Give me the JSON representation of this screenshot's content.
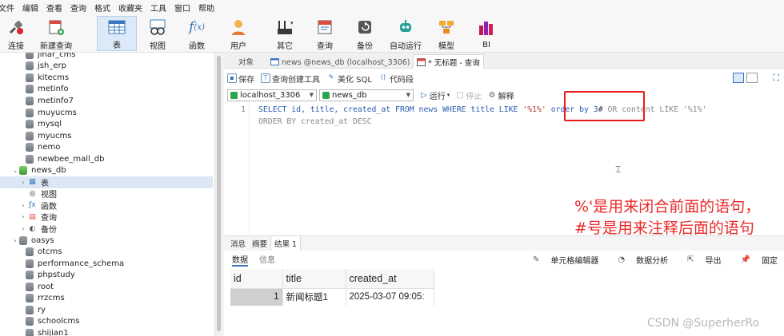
{
  "menu": [
    "文件",
    "编辑",
    "查看",
    "查询",
    "格式",
    "收藏夹",
    "工具",
    "窗口",
    "帮助"
  ],
  "toolbar": {
    "items": [
      {
        "label": "连接",
        "icon": "connect-icon"
      },
      {
        "label": "新建查询",
        "icon": "new-query-icon"
      },
      {
        "label": "表",
        "icon": "table-icon"
      },
      {
        "label": "视图",
        "icon": "view-icon"
      },
      {
        "label": "函数",
        "icon": "function-icon"
      },
      {
        "label": "用户",
        "icon": "user-icon"
      },
      {
        "label": "其它",
        "icon": "other-icon"
      },
      {
        "label": "查询",
        "icon": "query-icon"
      },
      {
        "label": "备份",
        "icon": "backup-icon"
      },
      {
        "label": "自动运行",
        "icon": "robot-icon"
      },
      {
        "label": "模型",
        "icon": "model-icon"
      },
      {
        "label": "BI",
        "icon": "bi-icon"
      }
    ]
  },
  "sidebar": {
    "databases_top": [
      "jinar_cms",
      "jsh_erp",
      "kitecms",
      "metinfo",
      "metinfo7",
      "muyucms",
      "mysql",
      "myucms",
      "nemo",
      "newbee_mall_db",
      "news_db"
    ],
    "news_db_children": [
      "表",
      "视图",
      "函数",
      "查询",
      "备份"
    ],
    "databases_bottom": [
      "oasys",
      "otcms",
      "performance_schema",
      "phpstudy",
      "root",
      "rrzcms",
      "ry",
      "schoolcms",
      "shijian1"
    ]
  },
  "tabs": {
    "objects": "对象",
    "news_tab": "news @news_db (localhost_3306) - 表",
    "query_tab": "* 无标题 - 查询"
  },
  "querybar": {
    "save": "保存",
    "builder": "查询创建工具",
    "beautify": "美化 SQL",
    "snippet": "代码段"
  },
  "connbar": {
    "connection": "localhost_3306",
    "database": "news_db",
    "run": "运行",
    "stop": "停止",
    "explain": "解释"
  },
  "editor": {
    "line_number": "1",
    "line1_a": "SELECT id, title, created_at FROM news WHERE title LIKE ",
    "line1_str": "'%1%'",
    "line1_order": " order by 3",
    "line1_hash": "#",
    "line1_comment": " OR content LIKE '%1%'",
    "line2": "ORDER BY created_at DESC",
    "annotation1": "%'是用来闭合前面的语句，",
    "annotation2": "#号是用来注释后面的语句"
  },
  "result_tabs": [
    "消息",
    "摘要",
    "结果 1"
  ],
  "result_tools": {
    "data": "数据",
    "info": "信息",
    "cell_editor": "单元格编辑器",
    "analysis": "数据分析",
    "export": "导出",
    "pin": "固定"
  },
  "grid": {
    "columns": [
      "id",
      "title",
      "created_at"
    ],
    "rows": [
      [
        "1",
        "新闻标题1",
        "2025-03-07 09:05:"
      ]
    ]
  },
  "watermark": "CSDN @SuperherRo"
}
